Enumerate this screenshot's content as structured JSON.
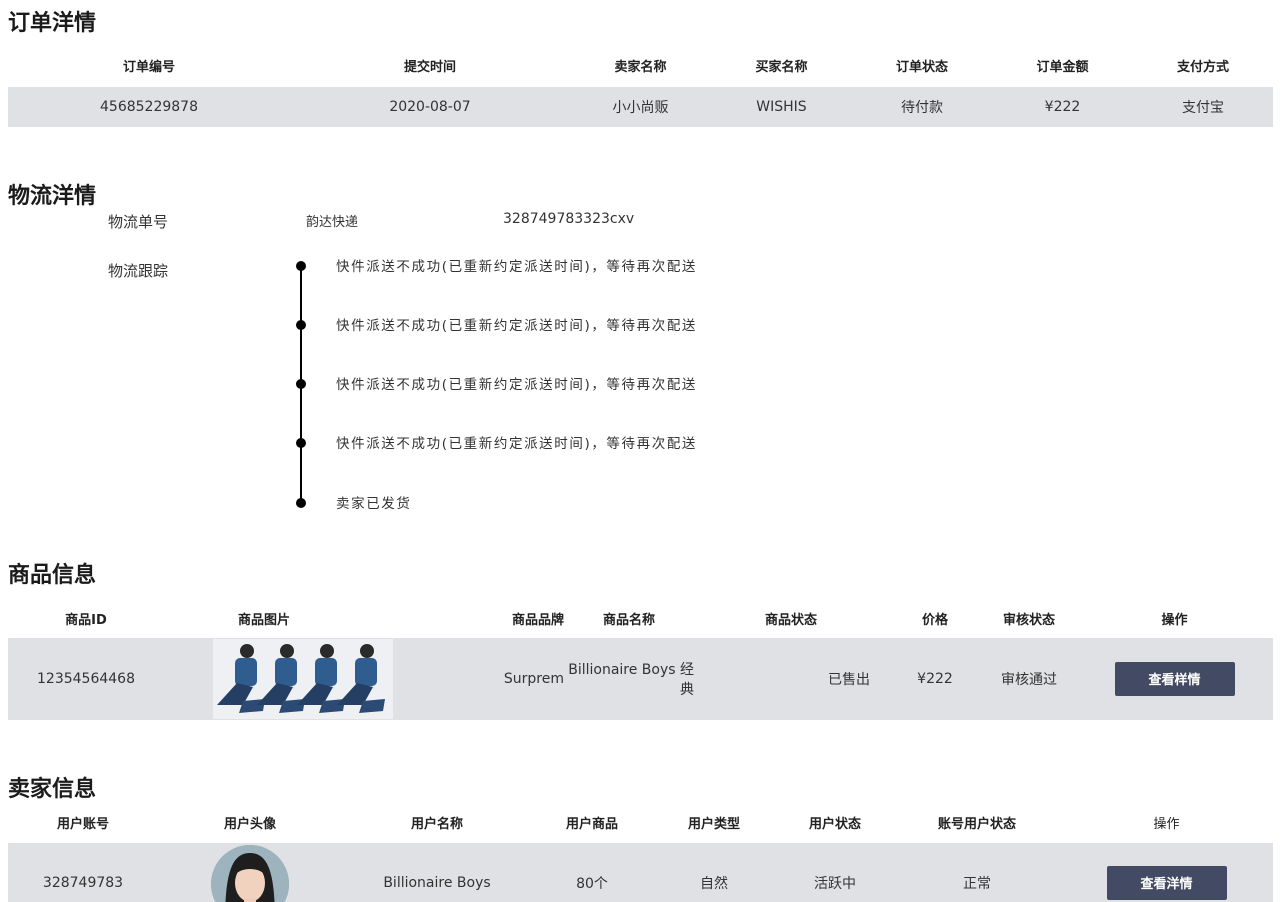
{
  "order": {
    "title": "订单洋情",
    "headers": [
      "订单编号",
      "提交时间",
      "卖家名称",
      "买家名称",
      "订单状态",
      "订单金额",
      "支付方式"
    ],
    "row": [
      "45685229878",
      "2020-08-07",
      "小小尚贩",
      "WISHIS",
      "待付款",
      "¥222",
      "支付宝"
    ]
  },
  "logistics": {
    "title": "物流洋情",
    "number_label": "物流单号",
    "company": "韵达快递",
    "number": "328749783323cxv",
    "tracking_label": "物流跟踪",
    "events": [
      "快件派送不成功(已重新约定派送时间)，等待再次配送",
      "快件派送不成功(已重新约定派送时间)，等待再次配送",
      "快件派送不成功(已重新约定派送时间)，等待再次配送",
      "快件派送不成功(已重新约定派送时间)，等待再次配送",
      "卖家已发货"
    ]
  },
  "product": {
    "title": "商品信息",
    "headers": [
      "商品ID",
      "商品图片",
      "商品品牌",
      "商品名称",
      "商品状态",
      "价格",
      "审核状态",
      "操作"
    ],
    "row": {
      "id": "12354564468",
      "brand": "Surprem",
      "name": "Billionaire Boys 经典",
      "status": "已售出",
      "price": "¥222",
      "review": "审核通过",
      "action": "查看样情"
    },
    "review_color": "#1a8a1a"
  },
  "seller": {
    "title": "卖家信息",
    "headers": [
      "用户账号",
      "用户头像",
      "用户名称",
      "用户商品",
      "用户类型",
      "用户状态",
      "账号用户状态",
      "操作"
    ],
    "row": {
      "account": "328749783",
      "name": "Billionaire Boys",
      "goods": "80个",
      "type": "自然",
      "status": "活跃中",
      "account_status": "正常",
      "action": "查看洋情"
    }
  },
  "colors": {
    "row_bg": "#dfe1e5",
    "button_bg": "#434a63",
    "status_green": "#1a8a1a"
  }
}
